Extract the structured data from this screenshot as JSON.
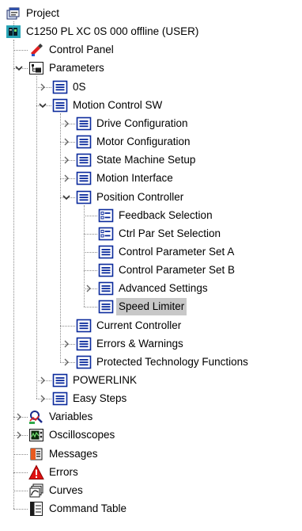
{
  "tree": {
    "nodes": [
      {
        "id": "project",
        "label": "Project",
        "level": 0,
        "icon": "project-icon",
        "toggle": "none"
      },
      {
        "id": "device",
        "label": "C1250 PL XC 0S 000 offline (USER)",
        "level": 0,
        "icon": "device-icon",
        "toggle": "expanded",
        "parent": "project"
      },
      {
        "id": "control-panel",
        "label": "Control Panel",
        "level": 1,
        "icon": "control-panel-icon",
        "toggle": "none",
        "parent": "device"
      },
      {
        "id": "parameters",
        "label": "Parameters",
        "level": 1,
        "icon": "parameters-icon",
        "toggle": "expanded",
        "parent": "device"
      },
      {
        "id": "os",
        "label": "0S",
        "level": 2,
        "icon": "parameter-group-icon",
        "toggle": "collapsed",
        "parent": "parameters"
      },
      {
        "id": "motion-control-sw",
        "label": "Motion Control SW",
        "level": 2,
        "icon": "parameter-group-icon",
        "toggle": "expanded",
        "parent": "parameters"
      },
      {
        "id": "drive-configuration",
        "label": "Drive Configuration",
        "level": 3,
        "icon": "parameter-group-icon",
        "toggle": "collapsed",
        "parent": "motion-control-sw"
      },
      {
        "id": "motor-configuration",
        "label": "Motor Configuration",
        "level": 3,
        "icon": "parameter-group-icon",
        "toggle": "collapsed",
        "parent": "motion-control-sw"
      },
      {
        "id": "state-machine-setup",
        "label": "State Machine Setup",
        "level": 3,
        "icon": "parameter-group-icon",
        "toggle": "collapsed",
        "parent": "motion-control-sw"
      },
      {
        "id": "motion-interface",
        "label": "Motion Interface",
        "level": 3,
        "icon": "parameter-group-icon",
        "toggle": "collapsed",
        "parent": "motion-control-sw"
      },
      {
        "id": "position-controller",
        "label": "Position Controller",
        "level": 3,
        "icon": "parameter-group-icon",
        "toggle": "expanded",
        "parent": "motion-control-sw"
      },
      {
        "id": "feedback-selection",
        "label": "Feedback Selection",
        "level": 4,
        "icon": "selection-list-icon",
        "toggle": "none",
        "parent": "position-controller"
      },
      {
        "id": "ctrl-par-set-selection",
        "label": "Ctrl Par Set Selection",
        "level": 4,
        "icon": "selection-list-icon",
        "toggle": "none",
        "parent": "position-controller"
      },
      {
        "id": "control-parameter-set-a",
        "label": "Control Parameter Set A",
        "level": 4,
        "icon": "parameter-group-icon",
        "toggle": "none",
        "parent": "position-controller"
      },
      {
        "id": "control-parameter-set-b",
        "label": "Control Parameter Set B",
        "level": 4,
        "icon": "parameter-group-icon",
        "toggle": "none",
        "parent": "position-controller"
      },
      {
        "id": "advanced-settings",
        "label": "Advanced Settings",
        "level": 4,
        "icon": "parameter-group-icon",
        "toggle": "collapsed",
        "parent": "position-controller"
      },
      {
        "id": "speed-limiter",
        "label": "Speed Limiter",
        "level": 4,
        "icon": "parameter-group-icon",
        "toggle": "none",
        "parent": "position-controller",
        "selected": true
      },
      {
        "id": "current-controller",
        "label": "Current Controller",
        "level": 3,
        "icon": "parameter-group-icon",
        "toggle": "none",
        "parent": "motion-control-sw"
      },
      {
        "id": "errors-warnings",
        "label": "Errors & Warnings",
        "level": 3,
        "icon": "parameter-group-icon",
        "toggle": "collapsed",
        "parent": "motion-control-sw"
      },
      {
        "id": "protected-technology-functions",
        "label": "Protected Technology Functions",
        "level": 3,
        "icon": "parameter-group-icon",
        "toggle": "collapsed",
        "parent": "motion-control-sw"
      },
      {
        "id": "powerlink",
        "label": "POWERLINK",
        "level": 2,
        "icon": "parameter-group-icon",
        "toggle": "collapsed",
        "parent": "parameters"
      },
      {
        "id": "easy-steps",
        "label": "Easy Steps",
        "level": 2,
        "icon": "parameter-group-icon",
        "toggle": "collapsed",
        "parent": "parameters"
      },
      {
        "id": "variables",
        "label": "Variables",
        "level": 1,
        "icon": "variables-icon",
        "toggle": "collapsed",
        "parent": "device"
      },
      {
        "id": "oscilloscopes",
        "label": "Oscilloscopes",
        "level": 1,
        "icon": "oscilloscope-icon",
        "toggle": "collapsed",
        "parent": "device"
      },
      {
        "id": "messages",
        "label": "Messages",
        "level": 1,
        "icon": "messages-icon",
        "toggle": "none",
        "parent": "device"
      },
      {
        "id": "errors",
        "label": "Errors",
        "level": 1,
        "icon": "error-warning-icon",
        "toggle": "none",
        "parent": "device"
      },
      {
        "id": "curves",
        "label": "Curves",
        "level": 1,
        "icon": "curves-icon",
        "toggle": "none",
        "parent": "device"
      },
      {
        "id": "command-table",
        "label": "Command Table",
        "level": 1,
        "icon": "command-table-icon",
        "toggle": "none",
        "parent": "device"
      }
    ]
  },
  "colors": {
    "selection_background": "#c8c8c8",
    "group_icon_blue": "#0a2a9c",
    "device_icon_teal": "#2aa5b6",
    "error_red": "#e01010",
    "tree_line": "#8a8a8a"
  }
}
